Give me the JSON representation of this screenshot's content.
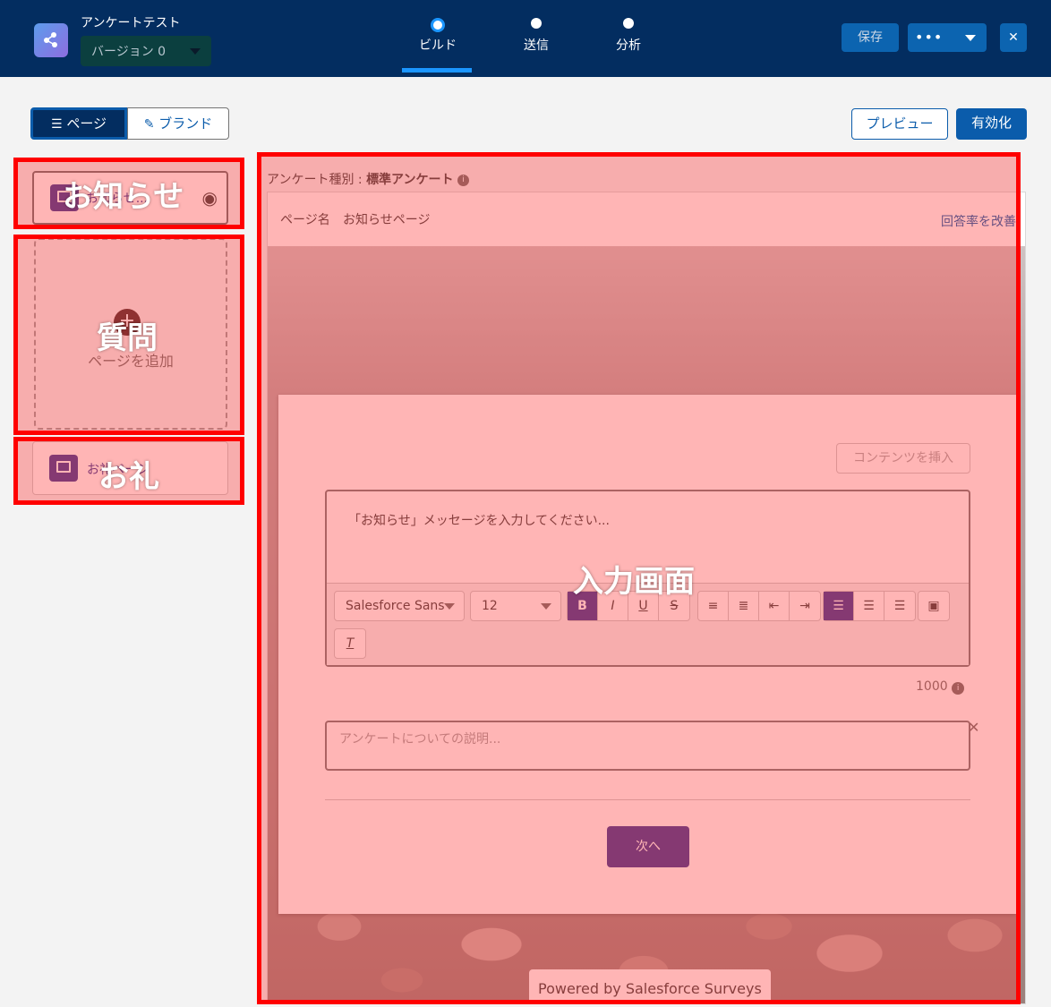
{
  "header": {
    "app_title": "アンケートテスト",
    "version": "バージョン 0",
    "steps": [
      {
        "label": "ビルド",
        "active": true
      },
      {
        "label": "送信",
        "active": false
      },
      {
        "label": "分析",
        "active": false
      }
    ],
    "save_label": "保存",
    "more_label": "•••",
    "close_label": "✕"
  },
  "toolbar": {
    "tab_page": "ページ",
    "tab_brand": "ブランド",
    "preview_label": "プレビュー",
    "activate_label": "有効化"
  },
  "sidebar": {
    "welcome_card_label": "お知らせ...",
    "add_page_label": "ページを追加",
    "add_plus": "+",
    "thanks_card_label": "お礼ページ"
  },
  "canvas": {
    "survey_type_prefix": "アンケート種別 : ",
    "survey_type_value": "標準アンケート",
    "page_name_label": "ページ名",
    "page_name_value": "お知らせページ",
    "improve_link": "回答率を改善",
    "insert_content_label": "コンテンツを挿入",
    "message_placeholder": "「お知らせ」メッセージを入力してください...",
    "font_family": "Salesforce Sans",
    "font_size": "12",
    "format_buttons": [
      "B",
      "I",
      "U",
      "S"
    ],
    "char_count": "1000",
    "description_placeholder": "アンケートについての説明...",
    "next_label": "次へ",
    "powered_by": "Powered by Salesforce Surveys"
  },
  "annotations": {
    "welcome": "お知らせ",
    "question": "質問",
    "thanks": "お礼",
    "input_screen": "入力画面"
  },
  "colors": {
    "header_bg": "#032d60",
    "accent_blue": "#0b5cab",
    "button_purple": "#3a3894",
    "overlay_red": "#ff0000"
  }
}
